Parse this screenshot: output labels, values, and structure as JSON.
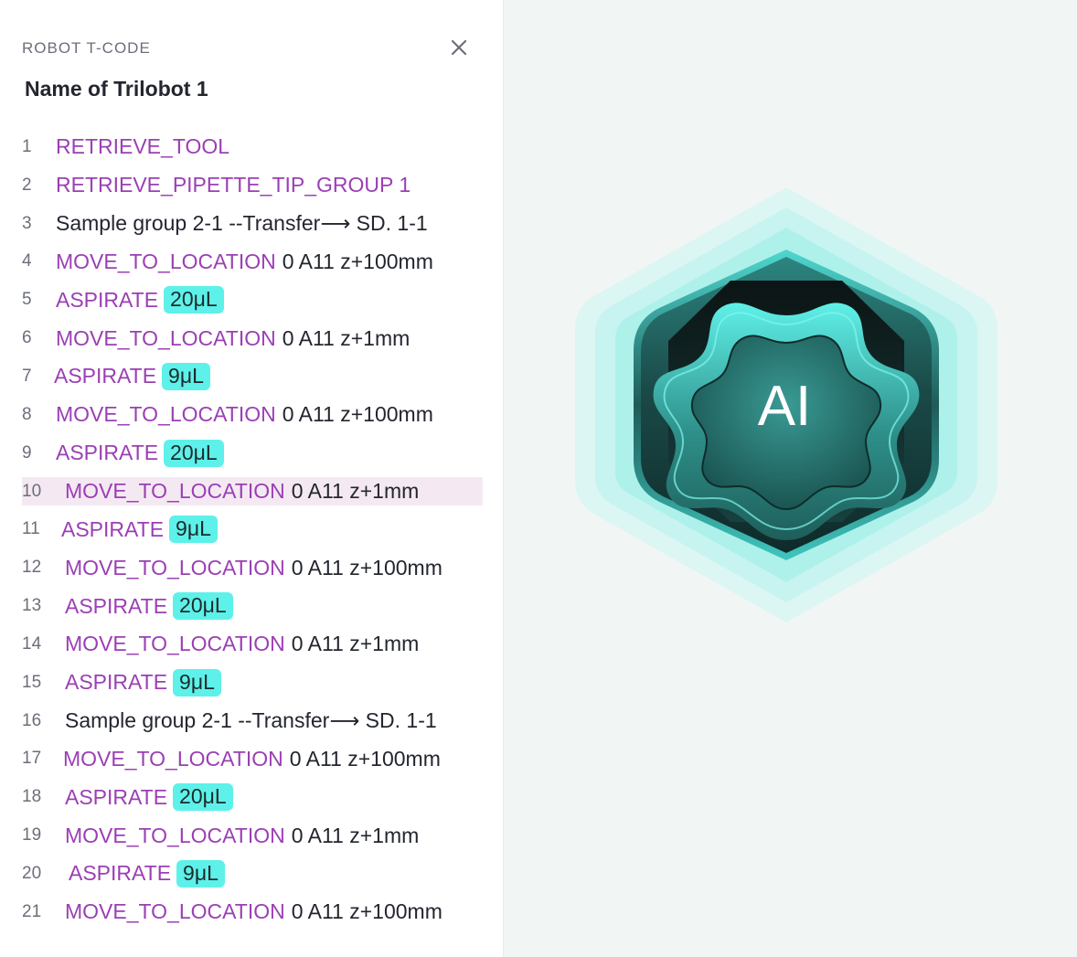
{
  "panel": {
    "label": "ROBOT T-CODE",
    "robot_name": "Name of Trilobot 1"
  },
  "lines": [
    {
      "num": "1",
      "kw": "RETRIEVE_TOOL"
    },
    {
      "num": "2",
      "kw": "RETRIEVE_PIPETTE_TIP_GROUP 1"
    },
    {
      "num": "3",
      "text": "Sample group 2-1 --Transfer⟶ SD. 1-1"
    },
    {
      "num": "4",
      "kw": "MOVE_TO_LOCATION",
      "arg": "0 A11 z+100mm"
    },
    {
      "num": "5",
      "kw": "ASPIRATE",
      "volume": "20μL"
    },
    {
      "num": "6",
      "kw": "MOVE_TO_LOCATION",
      "arg": "0 A11 z+1mm"
    },
    {
      "num": "7",
      "kw": "ASPIRATE",
      "volume": "9μL"
    },
    {
      "num": "8",
      "kw": "MOVE_TO_LOCATION",
      "arg": "0 A11 z+100mm"
    },
    {
      "num": "9",
      "kw": "ASPIRATE",
      "volume": "20μL"
    },
    {
      "num": "10",
      "kw": "MOVE_TO_LOCATION",
      "arg": "0 A11 z+1mm",
      "highlighted": true
    },
    {
      "num": "11",
      "kw": "ASPIRATE",
      "volume": "9μL"
    },
    {
      "num": "12",
      "kw": "MOVE_TO_LOCATION",
      "arg": "0 A11 z+100mm"
    },
    {
      "num": "13",
      "kw": "ASPIRATE",
      "volume": "20μL"
    },
    {
      "num": "14",
      "kw": "MOVE_TO_LOCATION",
      "arg": "0 A11 z+1mm"
    },
    {
      "num": "15",
      "kw": "ASPIRATE",
      "volume": "9μL"
    },
    {
      "num": "16",
      "text": "Sample group 2-1 --Transfer⟶ SD. 1-1"
    },
    {
      "num": "17",
      "kw": "MOVE_TO_LOCATION",
      "arg": "0 A11 z+100mm"
    },
    {
      "num": "18",
      "kw": "ASPIRATE",
      "volume": "20μL"
    },
    {
      "num": "19",
      "kw": "MOVE_TO_LOCATION",
      "arg": "0 A11 z+1mm"
    },
    {
      "num": "20",
      "kw": "ASPIRATE",
      "volume": "9μL"
    },
    {
      "num": "21",
      "kw": "MOVE_TO_LOCATION",
      "arg": "0 A11 z+100mm"
    }
  ],
  "badge": {
    "text": "AI",
    "icon": "ai-badge-icon"
  },
  "colors": {
    "keyword": "#9b3fb4",
    "volume_bg": "#5df1ea",
    "highlight_bg": "#f4e9f3",
    "badge_teal": "#1f5b58"
  }
}
